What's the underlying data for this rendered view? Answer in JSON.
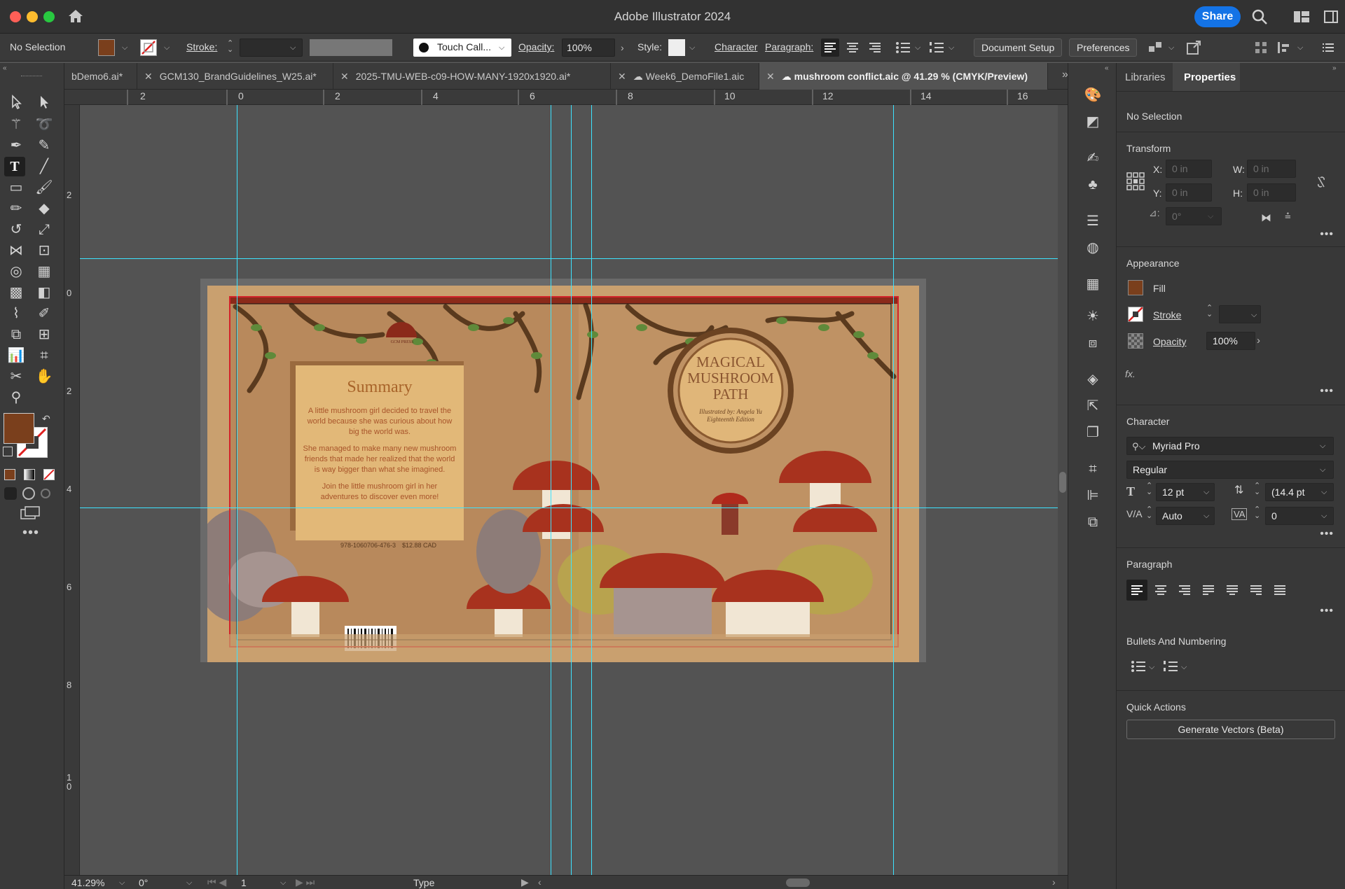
{
  "window": {
    "title": "Adobe Illustrator 2024",
    "share_label": "Share"
  },
  "control_bar": {
    "selection": "No Selection",
    "stroke_label": "Stroke:",
    "brush_name": "Touch Call...",
    "opacity_label": "Opacity:",
    "opacity_value": "100%",
    "style_label": "Style:",
    "character_label": "Character",
    "paragraph_label": "Paragraph:",
    "document_setup": "Document Setup",
    "preferences": "Preferences",
    "fill_color": "#7a3f1c"
  },
  "tabs": [
    {
      "label": "bDemo6.ai*",
      "active": false,
      "cloud": false
    },
    {
      "label": "GCM130_BrandGuidelines_W25.ai*",
      "active": false,
      "cloud": false
    },
    {
      "label": "2025-TMU-WEB-c09-HOW-MANY-1920x1920.ai*",
      "active": false,
      "cloud": false
    },
    {
      "label": "Week6_DemoFile1.aic",
      "active": false,
      "cloud": true
    },
    {
      "label": "mushroom conflict.aic @ 41.29 % (CMYK/Preview)",
      "active": true,
      "cloud": true
    }
  ],
  "ruler_top": [
    "2",
    "0",
    "2",
    "4",
    "6",
    "8",
    "10",
    "12",
    "14",
    "16"
  ],
  "ruler_left": [
    "2",
    "0",
    "2",
    "4",
    "6",
    "8",
    "10"
  ],
  "artwork": {
    "summary_title": "Summary",
    "summary_p1": "A little mushroom girl decided to travel the world because she was curious about how big the world was.",
    "summary_p2": "She managed to make many new mushroom friends that made her realized that the world is way bigger than what she imagined.",
    "summary_p3": "Join the little mushroom girl in her adventures to discover even more!",
    "isbn": "978-1060706-476-3",
    "price": "$12.88 CAD",
    "publisher": "GCM PRESS",
    "title_line1": "MAGICAL",
    "title_line2": "MUSHROOM",
    "title_line3": "PATH",
    "credit_line1": "Illustrated by: Angela Yu",
    "credit_line2": "Eighteenth Edition"
  },
  "status_bar": {
    "zoom": "41.29%",
    "rotation": "0°",
    "artboard": "1",
    "mode": "Type"
  },
  "panel": {
    "tab_libraries": "Libraries",
    "tab_properties": "Properties",
    "selection": "No Selection",
    "transform": {
      "title": "Transform",
      "x_label": "X:",
      "x_value": "0 in",
      "y_label": "Y:",
      "y_value": "0 in",
      "w_label": "W:",
      "w_value": "0 in",
      "h_label": "H:",
      "h_value": "0 in",
      "angle_value": "0°"
    },
    "appearance": {
      "title": "Appearance",
      "fill_label": "Fill",
      "stroke_label": "Stroke",
      "opacity_label": "Opacity",
      "opacity_value": "100%",
      "fx_label": "fx."
    },
    "character": {
      "title": "Character",
      "font": "Myriad Pro",
      "style": "Regular",
      "size": "12 pt",
      "leading": "(14.4 pt",
      "kerning": "Auto",
      "tracking": "0"
    },
    "paragraph": {
      "title": "Paragraph"
    },
    "bullets": {
      "title": "Bullets And Numbering"
    },
    "quick_actions": {
      "title": "Quick Actions",
      "generate_label": "Generate Vectors (Beta)"
    }
  }
}
